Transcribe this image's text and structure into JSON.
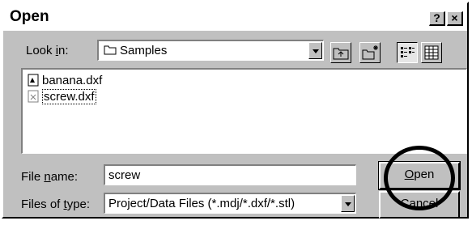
{
  "window": {
    "title": "Open",
    "help_label": "?",
    "close_label": "×"
  },
  "look_in": {
    "label_pre": "Look ",
    "label_key": "i",
    "label_post": "n:",
    "value": "Samples"
  },
  "toolbar": {
    "up_icon": "folder-up-icon",
    "new_folder_icon": "new-folder-icon",
    "list_icon": "list-view-icon",
    "details_icon": "details-view-icon"
  },
  "files": [
    {
      "name": "banana.dxf",
      "icon": "dxf-file-icon",
      "selected": false
    },
    {
      "name": "screw.dxf",
      "icon": "dxf-file-icon",
      "selected": true
    }
  ],
  "file_name": {
    "label_pre": "File ",
    "label_key": "n",
    "label_post": "ame:",
    "value": "screw"
  },
  "file_type": {
    "label_pre": "Files of ",
    "label_key": "t",
    "label_post": "ype:",
    "value": "Project/Data Files (*.mdj/*.dxf/*.stl)"
  },
  "buttons": {
    "open_key": "O",
    "open_rest": "pen",
    "cancel": "Cancel"
  }
}
